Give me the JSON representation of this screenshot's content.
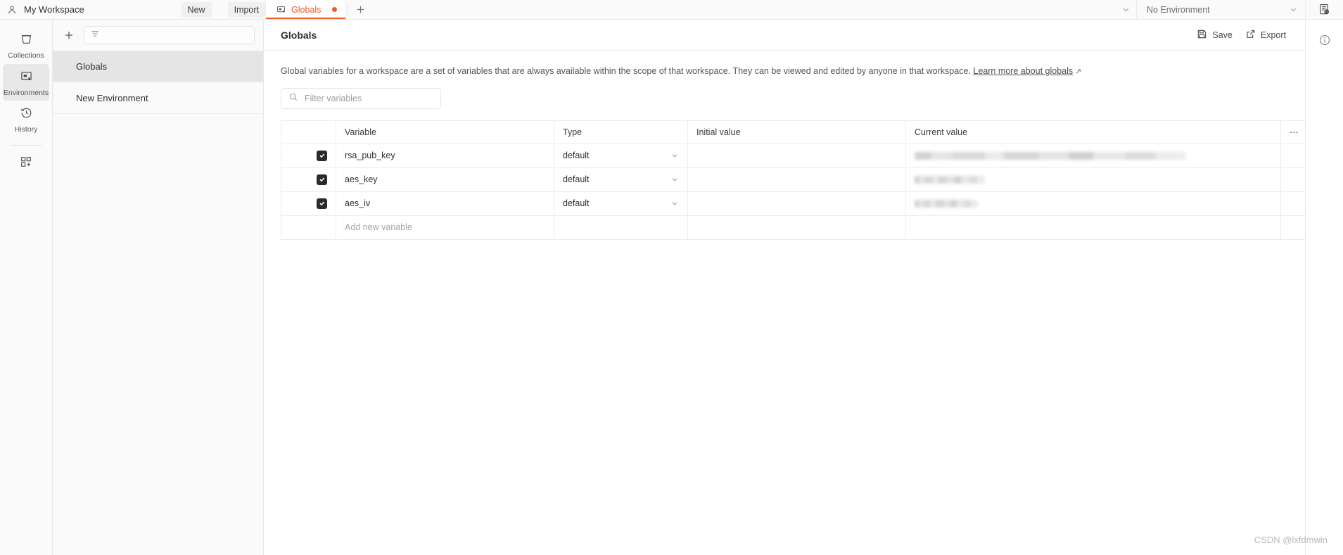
{
  "topbar": {
    "workspace_icon": "user-icon",
    "workspace_name": "My Workspace",
    "new_label": "New",
    "import_label": "Import",
    "tab": {
      "icon": "environment-icon",
      "label": "Globals",
      "unsaved_dot": "●"
    },
    "new_tab_icon": "plus-icon",
    "tabs_chevron_icon": "chevron-down-icon",
    "environment_selector": {
      "value": "No Environment",
      "chevron_icon": "chevron-down-icon"
    },
    "quick_look_icon": "environment-quick-look-icon"
  },
  "rail": {
    "items": [
      {
        "label": "Collections",
        "icon": "collections-icon",
        "active": false
      },
      {
        "label": "Environments",
        "icon": "environments-icon",
        "active": true
      },
      {
        "label": "History",
        "icon": "history-icon",
        "active": false
      }
    ],
    "apps_icon": "apps-grid-icon"
  },
  "sidebar": {
    "create_icon": "plus-icon",
    "filter_icon": "filter-lines-icon",
    "filter_placeholder": "",
    "items": [
      {
        "label": "Globals",
        "active": true
      },
      {
        "label": "New Environment",
        "active": false
      }
    ]
  },
  "main": {
    "title": "Globals",
    "save_label": "Save",
    "save_icon": "save-disk-icon",
    "export_label": "Export",
    "export_icon": "export-share-icon",
    "description": "Global variables for a workspace are a set of variables that are always available within the scope of that workspace. They can be viewed and edited by anyone in that workspace.",
    "learn_more_label": "Learn more about globals",
    "external_link_icon": "↗",
    "filter": {
      "icon": "search-icon",
      "placeholder": "Filter variables",
      "value": ""
    },
    "table": {
      "columns": [
        "Variable",
        "Type",
        "Initial value",
        "Current value"
      ],
      "options_icon": "ellipsis-horizontal-icon",
      "rows": [
        {
          "checked": true,
          "variable": "rsa_pub_key",
          "type": "default",
          "initial_value": "",
          "current_value": "",
          "redacted": true,
          "redact_width": 385
        },
        {
          "checked": true,
          "variable": "aes_key",
          "type": "default",
          "initial_value": "",
          "current_value": "",
          "redacted": true,
          "redact_width": 100
        },
        {
          "checked": true,
          "variable": "aes_iv",
          "type": "default",
          "initial_value": "",
          "current_value": "",
          "redacted": true,
          "redact_width": 90
        }
      ],
      "add_row_placeholder": "Add new variable"
    }
  },
  "right_rail": {
    "info_icon": "info-circle-icon"
  },
  "watermark": "CSDN @lxfdmwin",
  "colors": {
    "accent": "#ef5b25",
    "sidebar_bg": "#fafafa",
    "active_item": "#e5e5e5",
    "text": "#2e2e2e",
    "muted": "#8a8a8a"
  }
}
